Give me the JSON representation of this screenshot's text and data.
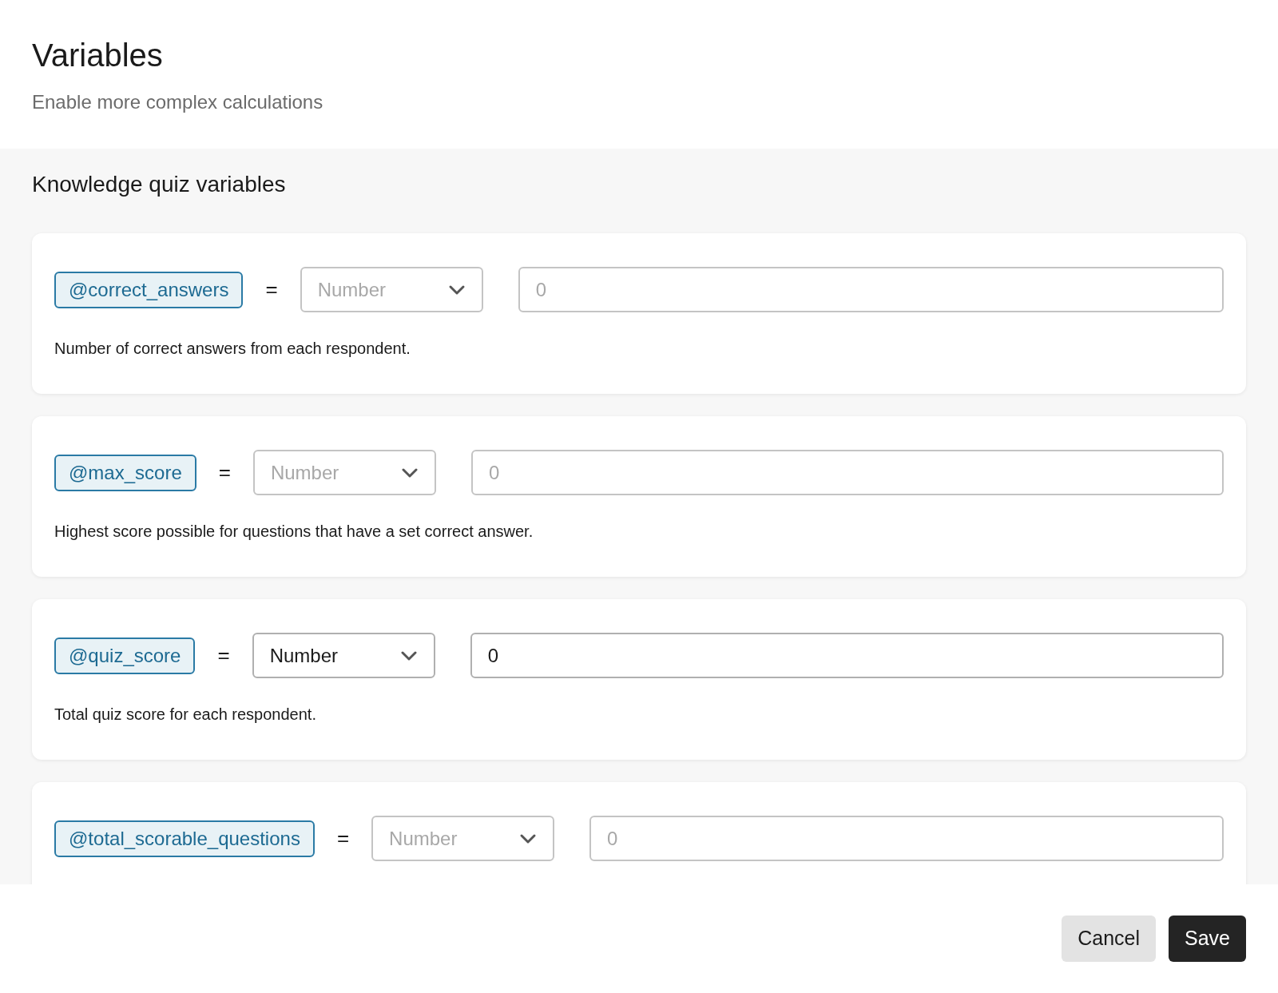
{
  "header": {
    "title": "Variables",
    "subtitle": "Enable more complex calculations"
  },
  "section": {
    "title": "Knowledge quiz variables"
  },
  "variables": [
    {
      "name": "@correct_answers",
      "operator": "=",
      "type_placeholder": "Number",
      "placeholder": "0",
      "description": "Number of correct answers from each respondent."
    },
    {
      "name": "@max_score",
      "operator": "=",
      "type_placeholder": "Number",
      "placeholder": "0",
      "description": "Highest score possible for questions that have a set correct answer."
    },
    {
      "name": "@quiz_score",
      "operator": "=",
      "type": "Number",
      "value": "0",
      "description": "Total quiz score for each respondent."
    },
    {
      "name": "@total_scorable_questions",
      "operator": "=",
      "type_placeholder": "Number",
      "placeholder": "0"
    }
  ],
  "buttons": [
    {
      "label": "Cancel",
      "kind": "secondary"
    },
    {
      "label": "Save",
      "kind": "primary"
    }
  ]
}
